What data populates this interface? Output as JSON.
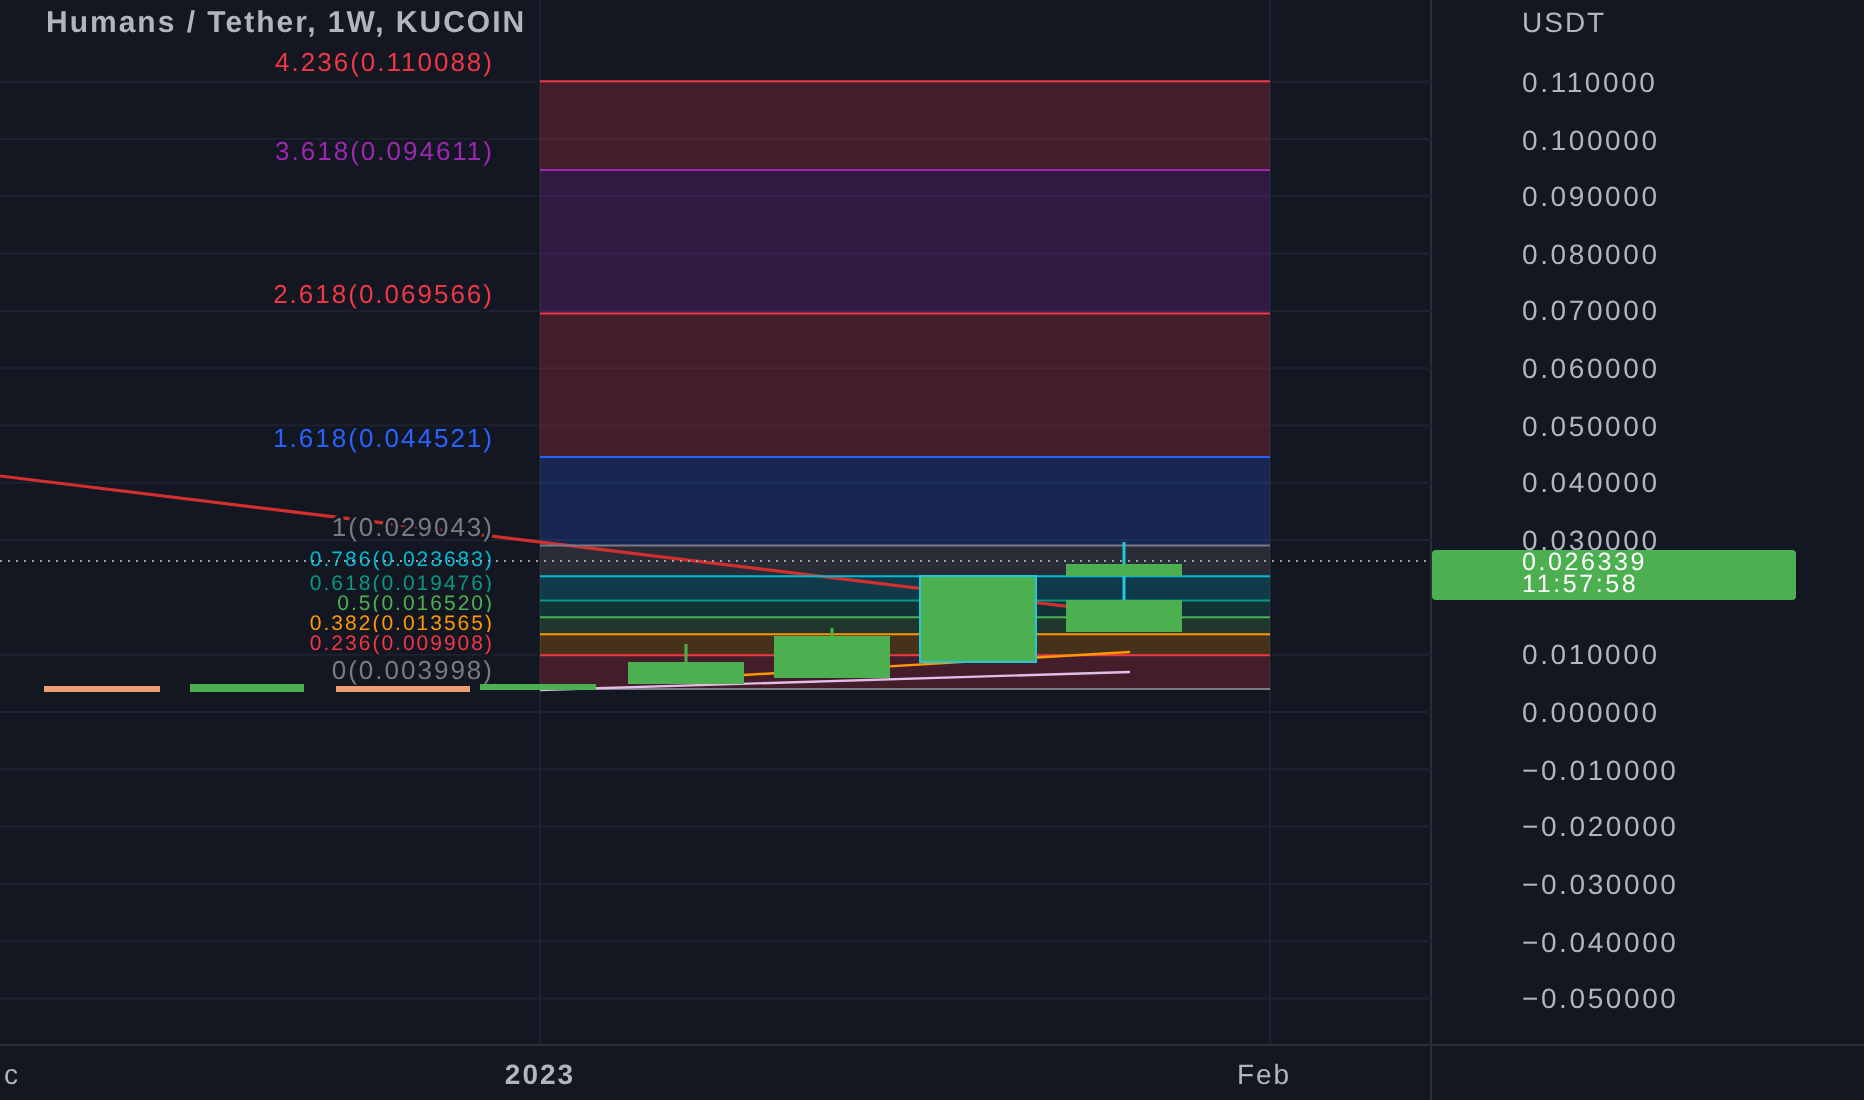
{
  "title": "Humans / Tether, 1W, KUCOIN",
  "fib_levels": [
    {
      "label": "4.236(0.110088)",
      "color": "#f23645"
    },
    {
      "label": "3.618(0.094611)",
      "color": "#9c27b0"
    },
    {
      "label": "2.618(0.069566)",
      "color": "#f23645"
    },
    {
      "label": "1.618(0.044521)",
      "color": "#2962ff"
    },
    {
      "label": "1(0.029043)",
      "color": "#787b86"
    },
    {
      "label": "0.786(0.023683)",
      "color": "#00bcd4"
    },
    {
      "label": "0.618(0.019476)",
      "color": "#089981"
    },
    {
      "label": "0.5(0.016520)",
      "color": "#4caf50"
    },
    {
      "label": "0.382(0.013565)",
      "color": "#ff9800"
    },
    {
      "label": "0.236(0.009908)",
      "color": "#f23645"
    },
    {
      "label": "0(0.003998)",
      "color": "#787b86"
    }
  ],
  "price_axis": {
    "currency": "USDT",
    "ticks": [
      "0.110000",
      "0.100000",
      "0.090000",
      "0.080000",
      "0.070000",
      "0.060000",
      "0.050000",
      "0.040000",
      "0.030000",
      "0.010000",
      "0.000000",
      "−0.010000",
      "−0.020000",
      "−0.030000",
      "−0.040000",
      "−0.050000"
    ],
    "last_price": "0.026339",
    "countdown": "11:57:58"
  },
  "time_axis": [
    "c",
    "2023",
    "Feb"
  ]
}
